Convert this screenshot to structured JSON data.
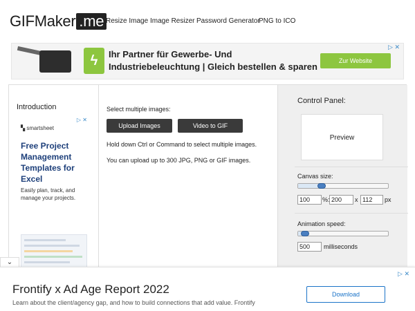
{
  "header": {
    "logo_main": "GIFMaker",
    "logo_suffix": ".me",
    "nav": [
      "Resize Image",
      "Image Resizer",
      "Password Generator",
      "PNG to ICO"
    ]
  },
  "top_ad": {
    "headline": "Ihr Partner für Gewerbe- Und Industriebeleuchtung | Gleich bestellen & sparen",
    "button": "Zur Website",
    "close": "▷ ✕",
    "icon_name": "lightning-icon",
    "accent_color": "#8dc63f"
  },
  "left": {
    "intro": "Introduction",
    "ad": {
      "brand": "smartsheet",
      "title": "Free Project Management Templates for Excel",
      "subtitle": "Easily plan, track, and manage your projects.",
      "close": "▷ ✕"
    }
  },
  "middle": {
    "select_label": "Select multiple images:",
    "upload_button": "Upload Images",
    "video_button": "Video to GIF",
    "hint1": "Hold down Ctrl or Command to select multiple images.",
    "hint2": "You can upload up to 300 JPG, PNG or GIF images."
  },
  "control_panel": {
    "title": "Control Panel:",
    "preview": "Preview",
    "canvas_label": "Canvas size:",
    "canvas_percent": "100",
    "percent_sign": "%:",
    "width": "200",
    "times": "x",
    "height": "112",
    "px": "px",
    "canvas_slider_level": 0.26,
    "speed_label": "Animation speed:",
    "speed": "500",
    "speed_unit": "milliseconds",
    "speed_slider_level": 0.08
  },
  "bottom_ad": {
    "title": "Frontify x Ad Age Report 2022",
    "subtitle": "Learn about the client/agency gap, and how to build connections that add value. Frontify",
    "button": "Download",
    "close": "▷ ✕",
    "collapse": "⌄"
  }
}
